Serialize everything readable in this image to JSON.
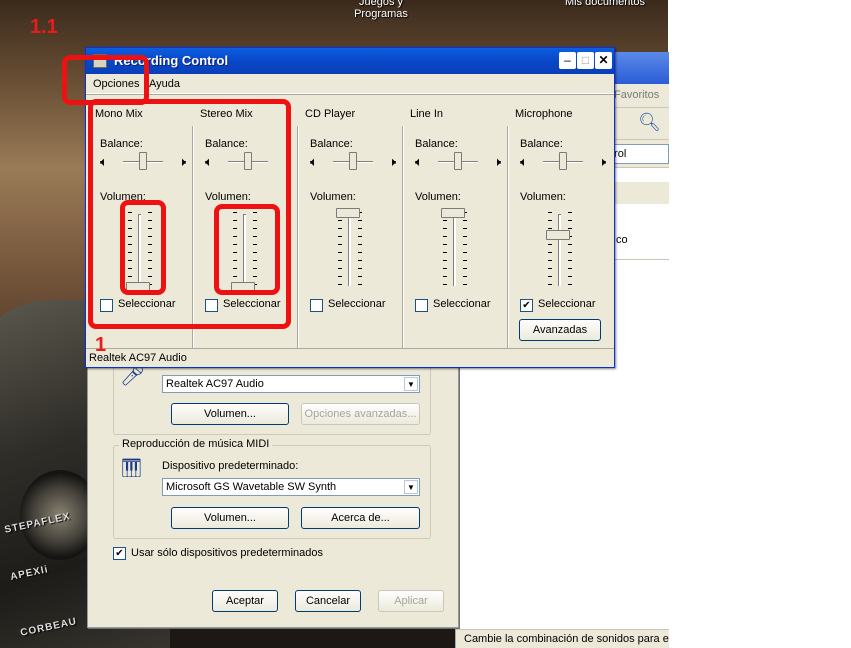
{
  "desktop": {
    "icons": [
      "Juegos y Programas",
      "Mis documentos"
    ],
    "decor": [
      "STEPAFLEX",
      "APEXIi",
      "CORBEAU"
    ]
  },
  "explorer": {
    "menu_favoritos": "Favoritos",
    "address_fragment": "trol",
    "list_fragment": "co",
    "status_text": "Cambie la combinación de sonidos para el e"
  },
  "properties": {
    "record_device": "Realtek AC97 Audio",
    "btn_volume": "Volumen...",
    "btn_advanced": "Opciones avanzadas...",
    "midi_group": "Reproducción de música MIDI",
    "midi_device_label": "Dispositivo predeterminado:",
    "midi_device": "Microsoft GS Wavetable SW Synth",
    "btn_volume2": "Volumen...",
    "btn_about": "Acerca de...",
    "use_default_label": "Usar sólo dispositivos predeterminados",
    "use_default_checked": "✔",
    "btn_ok": "Aceptar",
    "btn_cancel": "Cancelar",
    "btn_apply": "Aplicar"
  },
  "recording": {
    "title": "Recording Control",
    "menu": [
      "Opciones",
      "Ayuda"
    ],
    "balance_label": "Balance:",
    "volume_label": "Volumen:",
    "select_label": "Seleccionar",
    "channels": [
      {
        "name": "Mono Mix",
        "balance": 0.5,
        "volume": 0.0,
        "selected": false
      },
      {
        "name": "Stereo Mix",
        "balance": 0.5,
        "volume": 0.0,
        "selected": false
      },
      {
        "name": "CD Player",
        "balance": 0.5,
        "volume": 1.0,
        "selected": false
      },
      {
        "name": "Line In",
        "balance": 0.5,
        "volume": 1.0,
        "selected": false
      },
      {
        "name": "Microphone",
        "balance": 0.5,
        "volume": 0.7,
        "selected": true
      }
    ],
    "advanced_button": "Avanzadas",
    "status": "Realtek AC97 Audio"
  },
  "annotations": {
    "label_1_1": "1.1",
    "label_1": "1",
    "color": "#ee1111"
  }
}
